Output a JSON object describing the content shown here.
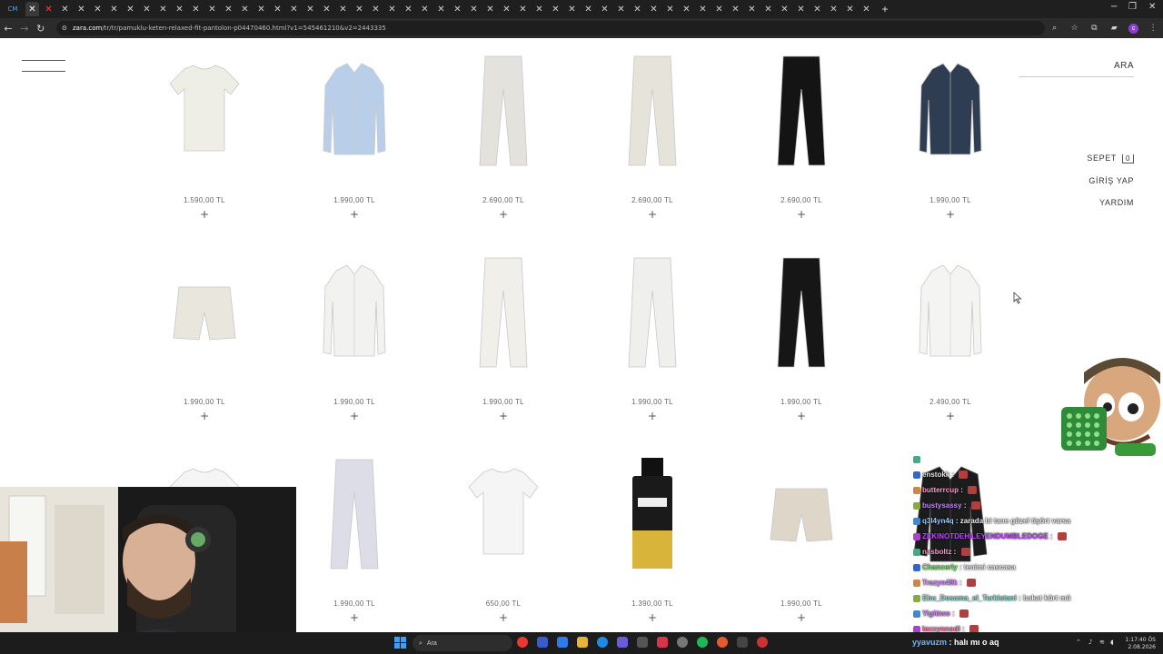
{
  "browser": {
    "url_host": "zara.com",
    "url_path": "/tr/tr/pamuklu-keten-relaxed-fit-pantolon-p04470460.html?v1=545461210&v2=2443335",
    "first_tab_label": "CM",
    "tab_close_glyph": "✕",
    "new_tab_glyph": "+",
    "profile_initial": "c"
  },
  "header": {
    "search_label": "ARA",
    "cart_label": "SEPET",
    "cart_count": "0",
    "login_label": "GİRİŞ YAP",
    "help_label": "YARDIM"
  },
  "products": [
    {
      "price": "1.590,00 TL",
      "add": "+",
      "kind": "tshirt",
      "color": "#efeee6"
    },
    {
      "price": "1.990,00 TL",
      "add": "+",
      "kind": "shirt",
      "color": "#b9cfe9"
    },
    {
      "price": "2.690,00 TL",
      "add": "+",
      "kind": "pants",
      "color": "#e4e2dc"
    },
    {
      "price": "2.690,00 TL",
      "add": "+",
      "kind": "pants",
      "color": "#e6e3da"
    },
    {
      "price": "2.690,00 TL",
      "add": "+",
      "kind": "pants",
      "color": "#141414"
    },
    {
      "price": "1.990,00 TL",
      "add": "+",
      "kind": "shirt",
      "color": "#2f3d52"
    },
    {
      "price": "1.990,00 TL",
      "add": "+",
      "kind": "shorts",
      "color": "#e9e6de"
    },
    {
      "price": "1.990,00 TL",
      "add": "+",
      "kind": "shirt",
      "color": "#f2f2f0"
    },
    {
      "price": "1.990,00 TL",
      "add": "+",
      "kind": "pants",
      "color": "#f0efea"
    },
    {
      "price": "1.990,00 TL",
      "add": "+",
      "kind": "pants",
      "color": "#efefee"
    },
    {
      "price": "1.990,00 TL",
      "add": "+",
      "kind": "pants",
      "color": "#161616"
    },
    {
      "price": "2.490,00 TL",
      "add": "+",
      "kind": "shirt",
      "color": "#f4f4f3"
    },
    {
      "price": "",
      "add": "",
      "kind": "tshirt",
      "color": "#f5f5f5"
    },
    {
      "price": "1.990,00 TL",
      "add": "+",
      "kind": "pants",
      "color": "#dcdde6"
    },
    {
      "price": "650,00 TL",
      "add": "+",
      "kind": "tshirt",
      "color": "#f5f5f5"
    },
    {
      "price": "1.390,00 TL",
      "add": "+",
      "kind": "perfume",
      "color": "#d8b43a"
    },
    {
      "price": "1.990,00 TL",
      "add": "+",
      "kind": "shorts",
      "color": "#ddd6c9"
    },
    {
      "price": "",
      "add": "",
      "kind": "jacket",
      "color": "#1c1c1c"
    }
  ],
  "chat": [
    {
      "user": "",
      "text": "",
      "color": "#ffffff"
    },
    {
      "user": "enstokk",
      "text": " : ",
      "color": "#e8e8e8",
      "emote": true
    },
    {
      "user": "butterrcup",
      "text": " : ",
      "color": "#ff9ecf",
      "emote": true
    },
    {
      "user": "bustysassy",
      "text": " : ",
      "color": "#c48bff",
      "emote": true
    },
    {
      "user": "q3l4yn4q",
      "text": " : zarada bi tane güzel tişört varsa",
      "color": "#9ad0ff"
    },
    {
      "user": "ZEKINOTDEHILEYENDUMBLEDOGE",
      "text": " : ",
      "color": "#c04cff",
      "emote": true
    },
    {
      "user": "nasboltz",
      "text": " : ",
      "color": "#ff9ecf",
      "emote": true
    },
    {
      "user": "Chancerly",
      "text": " : tenimi cascasa",
      "color": "#7fe36b"
    },
    {
      "user": "Trazyn40k",
      "text": " : ",
      "color": "#d88bff",
      "emote": true
    },
    {
      "user": "Ebu_Dosama_el_Turkistani",
      "text": " : bakat kürt mü",
      "color": "#8fe0d2"
    },
    {
      "user": "Yigittwo",
      "text": " : ",
      "color": "#d88bff",
      "emote": true
    },
    {
      "user": "lexxynnodi",
      "text": " : ",
      "color": "#ff7fb0",
      "emote": true
    }
  ],
  "taskbar": {
    "search_label": "Ara",
    "chat_user": "yyavuzm",
    "chat_text": " : halı mı o aq",
    "time": "1:17:40 ÖS",
    "date": "2.08.2026"
  },
  "colors": {
    "chrome_dark": "#1f1f1f",
    "address_bar": "#2b2b2b",
    "taskbar": "#1c1c1c",
    "page_bg": "#ffffff"
  }
}
